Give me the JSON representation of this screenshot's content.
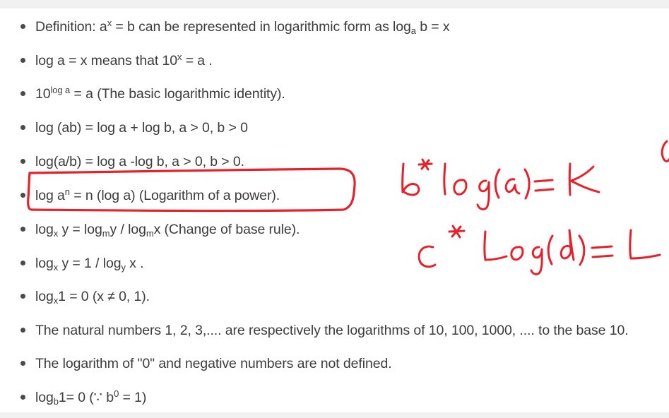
{
  "rules": [
    {
      "parts": [
        {
          "t": "Definition: a"
        },
        {
          "sup": "x"
        },
        {
          "t": " = b can be represented in logarithmic form as log"
        },
        {
          "sub": "a"
        },
        {
          "t": " b = x"
        }
      ]
    },
    {
      "parts": [
        {
          "t": "log a = x means that 10"
        },
        {
          "sup": "x"
        },
        {
          "t": " = a ."
        }
      ]
    },
    {
      "parts": [
        {
          "t": "10"
        },
        {
          "sup": "log a"
        },
        {
          "t": " = a (The basic logarithmic identity)."
        }
      ]
    },
    {
      "parts": [
        {
          "t": "log (ab) = log a + log b, a > 0, b > 0"
        }
      ]
    },
    {
      "parts": [
        {
          "t": "log(a/b) = log a -log b, a > 0, b > 0."
        }
      ]
    },
    {
      "parts": [
        {
          "t": "log a"
        },
        {
          "sup": "n"
        },
        {
          "t": " = n (log a) (Logarithm of a power)."
        }
      ]
    },
    {
      "parts": [
        {
          "t": "log"
        },
        {
          "sub": "x"
        },
        {
          "t": " y = log"
        },
        {
          "sub": "m"
        },
        {
          "t": "y / log"
        },
        {
          "sub": "m"
        },
        {
          "t": "x (Change of base rule)."
        }
      ]
    },
    {
      "parts": [
        {
          "t": "log"
        },
        {
          "sub": "x"
        },
        {
          "t": " y = 1 / log"
        },
        {
          "sub": "y"
        },
        {
          "t": " x ."
        }
      ]
    },
    {
      "parts": [
        {
          "t": "log"
        },
        {
          "sub": "x"
        },
        {
          "t": "1 = 0 (x ≠ 0, 1)."
        }
      ]
    },
    {
      "parts": [
        {
          "t": "The natural numbers 1, 2, 3,.... are respectively the logarithms of 10, 100, 1000, .... to the base 10."
        }
      ]
    },
    {
      "parts": [
        {
          "t": "The logarithm of \"0\" and negative numbers are not defined."
        }
      ]
    },
    {
      "parts": [
        {
          "t": "log"
        },
        {
          "sub": "b"
        },
        {
          "t": "1= 0 (∵ b"
        },
        {
          "sup": "0"
        },
        {
          "t": " = 1)"
        }
      ]
    }
  ],
  "annotations": {
    "ink_color": "#e8202a",
    "highlighted_rule_index": 5,
    "handwritten": [
      "b*log(a)=K",
      "c*Log(d)=L"
    ]
  }
}
